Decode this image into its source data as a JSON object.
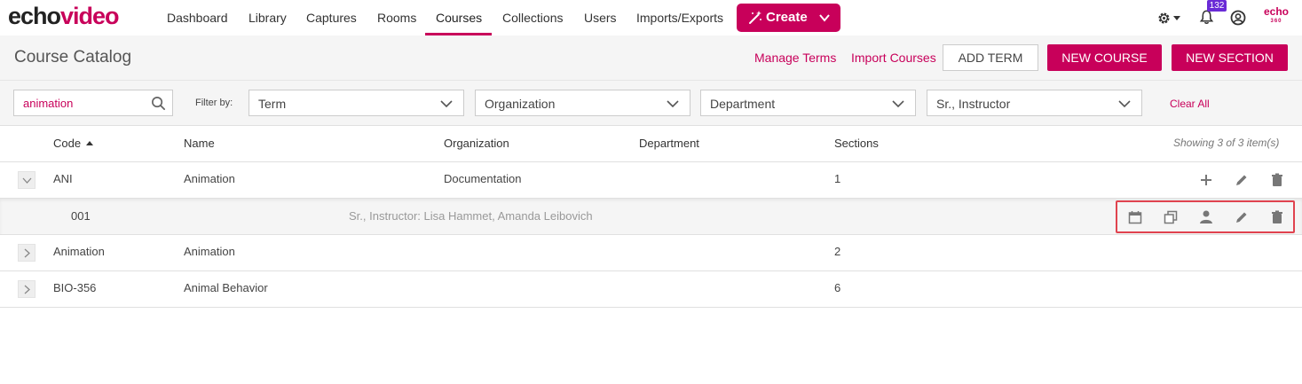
{
  "brand": {
    "echo": "echo",
    "video": "video",
    "mark_top": "echo",
    "mark_bottom": "360"
  },
  "nav": {
    "items": [
      "Dashboard",
      "Library",
      "Captures",
      "Rooms",
      "Courses",
      "Collections",
      "Users",
      "Imports/Exports"
    ],
    "active": "Courses",
    "create_label": "Create"
  },
  "notifications": {
    "count": "132"
  },
  "header": {
    "title": "Course Catalog",
    "manage_terms": "Manage Terms",
    "import_courses": "Import Courses",
    "add_term": "ADD TERM",
    "new_course": "NEW COURSE",
    "new_section": "NEW SECTION"
  },
  "filters": {
    "search_value": "animation",
    "filter_by_label": "Filter by:",
    "term": "Term",
    "organization": "Organization",
    "department": "Department",
    "instructor": "Sr., Instructor",
    "clear_all": "Clear All"
  },
  "table": {
    "columns": {
      "code": "Code",
      "name": "Name",
      "organization": "Organization",
      "department": "Department",
      "sections": "Sections"
    },
    "showing": "Showing 3 of 3 item(s)",
    "rows": [
      {
        "code": "ANI",
        "name": "Animation",
        "organization": "Documentation",
        "department": "",
        "sections": "1",
        "expanded": true
      },
      {
        "code": "Animation",
        "name": "Animation",
        "organization": "",
        "department": "",
        "sections": "2",
        "expanded": false
      },
      {
        "code": "BIO-356",
        "name": "Animal Behavior",
        "organization": "",
        "department": "",
        "sections": "6",
        "expanded": false
      }
    ],
    "section_row": {
      "code": "001",
      "instructors": "Sr., Instructor: Lisa Hammet, Amanda Leibovich"
    }
  },
  "colors": {
    "accent": "#c8005a",
    "badge": "#6a2bd6",
    "highlight": "#e0434f"
  },
  "icons": [
    "wand-icon",
    "chevron-down-icon",
    "gear-icon",
    "bell-icon",
    "user-circle-icon",
    "search-icon",
    "plus-icon",
    "pencil-icon",
    "trash-icon",
    "calendar-icon",
    "copy-icon",
    "person-icon",
    "chevron-right-icon"
  ]
}
